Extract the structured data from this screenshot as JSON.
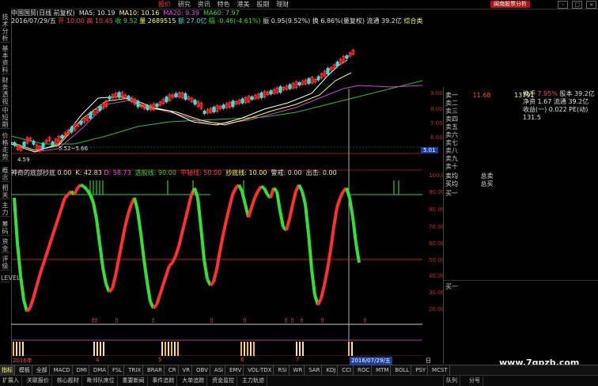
{
  "topbar": {
    "menu": [
      "报价",
      "研究",
      "资讯",
      "特色",
      "港美",
      "股期",
      "理财"
    ],
    "active_index": 0,
    "tag": "闽南股票分析",
    "window_controls": [
      "-",
      "□",
      "×"
    ]
  },
  "left_tabs": [
    "技术分析",
    "基本资料",
    "财务透视",
    "中短期",
    "价格走势",
    "概念",
    "相关",
    "主力",
    "筹码",
    "资金",
    "评级",
    "LEVEL"
  ],
  "header": {
    "stock": "中国国贸(日线 前复权)",
    "ma5_label": "MA5: 10.19",
    "ma10_label": "MA10: 10.16",
    "ma20_label": "MA20: 9.39",
    "ma60_label": "MA60: 7.97",
    "date": "2016/07/29/五",
    "open_label": "开 10.00",
    "high_label": "高 10.45",
    "low_label": "收 9.52",
    "vol_label": "量 2689515",
    "amount_label": "额 27.0亿",
    "change_label": "幅 -0.46(-4.61%)",
    "amp_label": "振 0.95(9.52%)",
    "turnover_label": "换 6.86%(量复权)",
    "float_label": "流通 39.2亿",
    "extra_label": "综合类"
  },
  "price_axis": [
    "9.00",
    "8.00",
    "7.00",
    "6.00",
    "5.01"
  ],
  "price_annotations": {
    "low": "4.59",
    "low2": "5.52~5.66"
  },
  "indicator_header": {
    "name": "神奇的底部抄底",
    "v1": "0.00",
    "k": "K: 42.83",
    "d": "D: 58.73",
    "buy": "选股线: 90.00",
    "mid": "中轴线: 50.00",
    "low": "抄底线: 10.00",
    "warn": "警戒: 0.00",
    "out": "出击: 0.00"
  },
  "indicator_axis": [
    "100.00",
    "90.00",
    "80.00",
    "70.00",
    "60.00",
    "50.00",
    "40.00",
    "30.00",
    "20.00"
  ],
  "right_panel": {
    "price_axis_cur": "5.01",
    "sell_rows": [
      {
        "label": "卖一",
        "price": "11.68",
        "vol": "13791"
      },
      {
        "label": "卖二",
        "price": "",
        "vol": ""
      },
      {
        "label": "卖三",
        "price": "",
        "vol": ""
      },
      {
        "label": "卖四",
        "price": "",
        "vol": ""
      },
      {
        "label": "卖五",
        "price": "",
        "vol": ""
      },
      {
        "label": "卖六",
        "price": "",
        "vol": ""
      },
      {
        "label": "卖七",
        "price": "",
        "vol": ""
      },
      {
        "label": "卖八",
        "price": "",
        "vol": ""
      },
      {
        "label": "卖九",
        "price": "",
        "vol": ""
      },
      {
        "label": "卖十",
        "price": "",
        "vol": ""
      }
    ],
    "sell_avg": "卖均",
    "buy_avg": "买均",
    "total_sell": "总卖",
    "total_buy": "总买",
    "buy_one": "买一",
    "buy_one_b": "买一",
    "stats": [
      {
        "k": "换手",
        "v": "7.95%",
        "k2": "股本",
        "v2": "39.2亿"
      },
      {
        "k": "净资",
        "v": "1.67",
        "k2": "流通",
        "v2": "39.2亿"
      },
      {
        "k": "收益(一)",
        "v": "0.022",
        "k2": "PE(动)",
        "v2": "131.5"
      }
    ],
    "bottom_tabs": [
      "队列",
      "分号"
    ],
    "daily_label": "日线"
  },
  "date_axis": {
    "start": "2016年",
    "m4": "4",
    "m5": "5",
    "m6": "6",
    "m7": "7",
    "cursor": "2016/07/29/五"
  },
  "bottom_tabs": [
    "指标",
    "模板",
    "全部",
    "MACD",
    "DMI",
    "DMA",
    "FSL",
    "TRIX",
    "BRAR",
    "CR",
    "VR",
    "OBV",
    "ASI",
    "EMV",
    "VOL-TDX",
    "RSI",
    "WR",
    "SAR",
    "KDJ",
    "CCI",
    "ROC",
    "MTM",
    "BOLL",
    "PSY",
    "MCST"
  ],
  "status_tabs": [
    "扩展入",
    "关联报价",
    "核心题材",
    "毗邻队席位",
    "重要新闻",
    "事件追踪",
    "大单追踪",
    "资金监控",
    "主力轨迹"
  ],
  "watermark": "www.7gpzb.com",
  "colors": {
    "up": "#ff3030",
    "down": "#33e033",
    "ma5": "#ffffff",
    "ma10": "#ffff33",
    "ma20": "#ff44ff",
    "ma60": "#33cc33"
  },
  "kd_series": {
    "x": [
      0,
      4,
      8,
      12,
      16,
      20,
      24,
      28,
      32,
      36,
      40,
      44,
      48,
      52,
      56,
      60,
      64,
      68,
      72,
      76,
      80,
      84,
      88,
      92,
      96,
      100,
      104,
      108,
      112,
      116,
      120,
      124,
      128,
      132,
      136,
      140,
      144,
      148,
      152,
      156,
      160,
      164,
      168,
      172,
      176,
      180,
      184,
      188,
      192,
      196,
      200,
      204,
      208,
      212,
      216,
      220,
      224,
      228,
      232,
      236,
      240,
      244,
      248,
      252,
      256,
      260,
      264,
      268,
      272,
      276,
      280,
      284,
      288,
      292,
      296,
      300,
      304,
      308,
      312,
      316,
      320,
      324,
      328,
      332,
      336,
      340,
      344,
      348,
      352,
      356,
      360,
      364,
      368,
      372,
      376,
      380,
      384,
      388,
      392,
      396,
      400,
      404,
      408,
      412,
      416,
      420,
      424,
      428,
      432,
      436,
      440,
      444,
      448,
      452,
      456,
      460,
      464,
      468,
      472,
      476,
      480,
      484,
      488,
      492,
      496,
      500,
      504,
      508
    ],
    "k": [
      88,
      60,
      40,
      25,
      18,
      20,
      26,
      33,
      40,
      46,
      52,
      58,
      64,
      70,
      76,
      82,
      88,
      90,
      92,
      90,
      94,
      96,
      95,
      93,
      90,
      85,
      75,
      60,
      45,
      35,
      30,
      32,
      40,
      50,
      60,
      70,
      78,
      84,
      88,
      80,
      66,
      50,
      36,
      24,
      20,
      22,
      28,
      34,
      40,
      46,
      48,
      52,
      58,
      66,
      74,
      82,
      90,
      94,
      88,
      70,
      50,
      38,
      34,
      36,
      44,
      55,
      65,
      74,
      82,
      90,
      94,
      96,
      92,
      84,
      76,
      82,
      88,
      92,
      95,
      94,
      90,
      88,
      94,
      92,
      80,
      70,
      68,
      75,
      84,
      92,
      96,
      92,
      84,
      66,
      44,
      28,
      22,
      26,
      34,
      44,
      56,
      70,
      82,
      88,
      92,
      94,
      88,
      76,
      60,
      48
    ]
  }
}
